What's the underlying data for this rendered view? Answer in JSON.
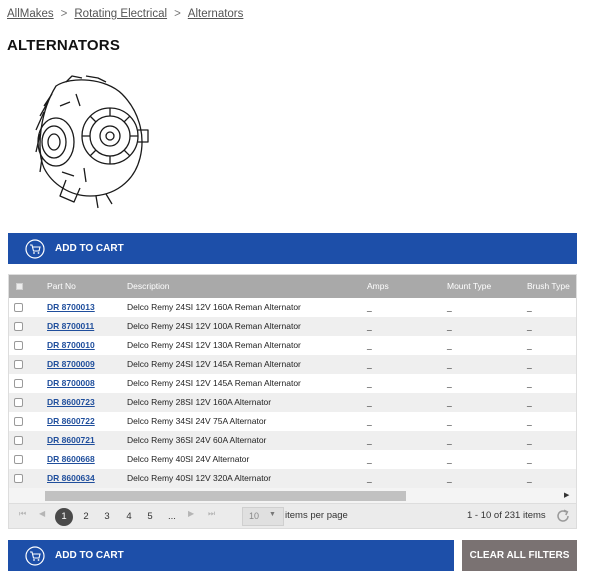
{
  "breadcrumb": {
    "items": [
      "AllMakes",
      "Rotating Electrical",
      "Alternators"
    ],
    "separator": ">"
  },
  "page": {
    "title": "ALTERNATORS"
  },
  "actions": {
    "add_to_cart": "ADD TO CART",
    "clear_all_filters": "CLEAR ALL FILTERS"
  },
  "grid": {
    "columns": [
      "Part No",
      "Description",
      "Amps",
      "Mount Type",
      "Brush Type"
    ],
    "rows": [
      {
        "part_no": "DR 8700013",
        "description": "Delco Remy 24SI 12V 160A Reman Alternator",
        "amps": "_",
        "mount_type": "_",
        "brush_type": "_"
      },
      {
        "part_no": "DR 8700011",
        "description": "Delco Remy 24SI 12V 100A Reman Alternator",
        "amps": "_",
        "mount_type": "_",
        "brush_type": "_"
      },
      {
        "part_no": "DR 8700010",
        "description": "Delco Remy 24SI 12V 130A Reman Alternator",
        "amps": "_",
        "mount_type": "_",
        "brush_type": "_"
      },
      {
        "part_no": "DR 8700009",
        "description": "Delco Remy 24SI 12V 145A Reman Alternator",
        "amps": "_",
        "mount_type": "_",
        "brush_type": "_"
      },
      {
        "part_no": "DR 8700008",
        "description": "Delco Remy 24SI 12V 145A Reman Alternator",
        "amps": "_",
        "mount_type": "_",
        "brush_type": "_"
      },
      {
        "part_no": "DR 8600723",
        "description": "Delco Remy 28SI 12V 160A Alternator",
        "amps": "_",
        "mount_type": "_",
        "brush_type": "_"
      },
      {
        "part_no": "DR 8600722",
        "description": "Delco Remy 34SI 24V 75A Alternator",
        "amps": "_",
        "mount_type": "_",
        "brush_type": "_"
      },
      {
        "part_no": "DR 8600721",
        "description": "Delco Remy 36SI 24V 60A Alternator",
        "amps": "_",
        "mount_type": "_",
        "brush_type": "_"
      },
      {
        "part_no": "DR 8600668",
        "description": "Delco Remy 40SI 24V Alternator",
        "amps": "_",
        "mount_type": "_",
        "brush_type": "_"
      },
      {
        "part_no": "DR 8600634",
        "description": "Delco Remy 40SI 12V 320A Alternator",
        "amps": "_",
        "mount_type": "_",
        "brush_type": "_"
      }
    ]
  },
  "pager": {
    "pages": [
      "1",
      "2",
      "3",
      "4",
      "5",
      "..."
    ],
    "current_page": "1",
    "page_size": "10",
    "items_per_page_label": "items per page",
    "info": "1 - 10 of 231 items",
    "icons": [
      "first-page-icon",
      "prev-page-icon",
      "next-page-icon",
      "last-page-icon",
      "refresh-icon"
    ]
  },
  "colors": {
    "accent_blue": "#1d4fa9",
    "header_gray": "#a9a9a9",
    "clear_button": "#7a7272",
    "link_blue": "#1f4e9c"
  }
}
